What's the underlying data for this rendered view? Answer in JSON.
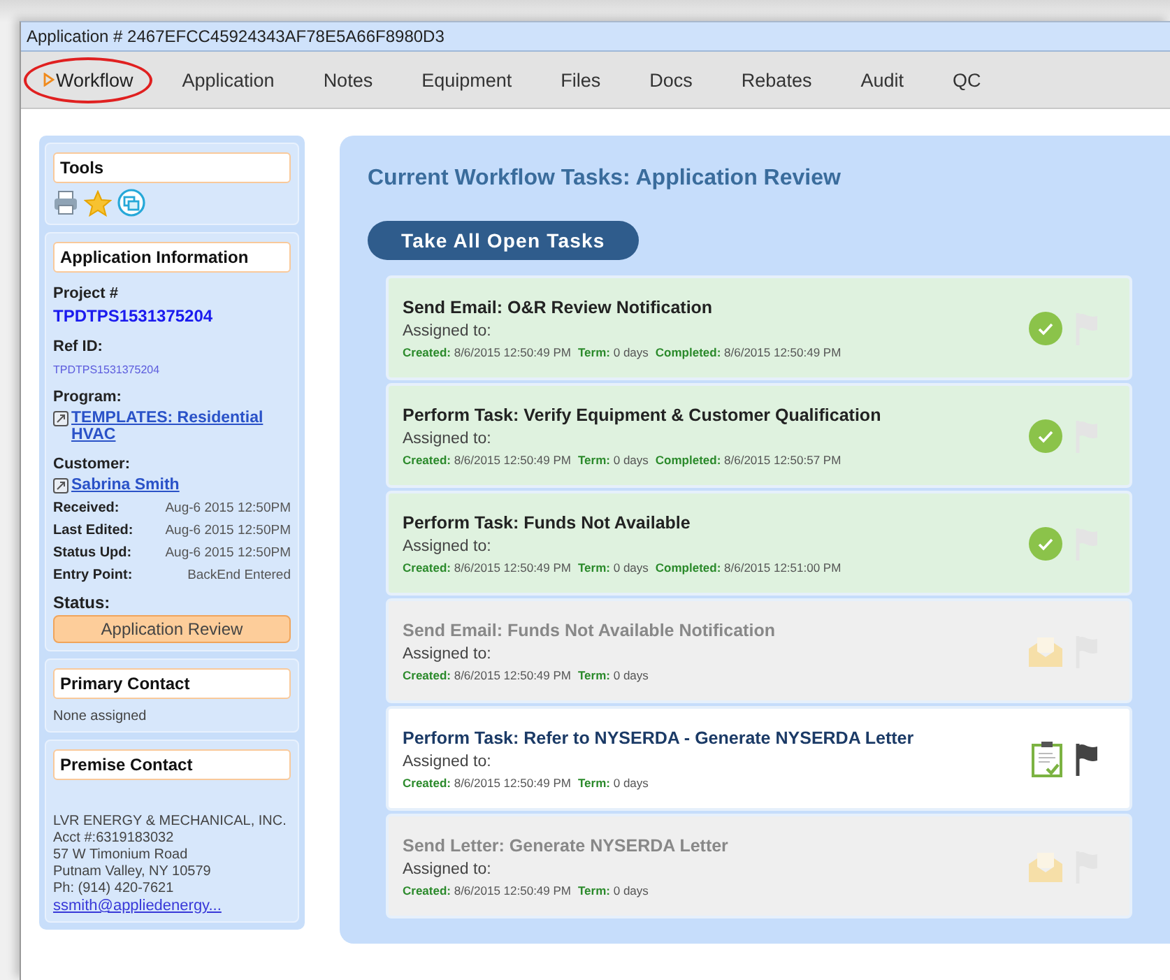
{
  "window": {
    "title": "Application # 2467EFCC45924343AF78E5A66F8980D3"
  },
  "tabs": [
    {
      "label": "Workflow",
      "selected": true,
      "circled": true
    },
    {
      "label": "Application",
      "selected": false,
      "circled": false
    },
    {
      "label": "Notes",
      "selected": false,
      "circled": false
    },
    {
      "label": "Equipment",
      "selected": false,
      "circled": false
    },
    {
      "label": "Files",
      "selected": false,
      "circled": false
    },
    {
      "label": "Docs",
      "selected": false,
      "circled": false
    },
    {
      "label": "Rebates",
      "selected": false,
      "circled": false
    },
    {
      "label": "Audit",
      "selected": false,
      "circled": false
    },
    {
      "label": "QC",
      "selected": false,
      "circled": false
    }
  ],
  "sidebar": {
    "tools": {
      "title": "Tools"
    },
    "info": {
      "title": "Application Information",
      "fields": [
        {
          "kind": "id",
          "label": "Project #",
          "value": "TPDTPS1531375204"
        },
        {
          "kind": "ref",
          "label": "Ref ID:",
          "value": "TPDTPS1531375204"
        },
        {
          "kind": "link",
          "label": "Program:",
          "value": "TEMPLATES: Residential HVAC"
        },
        {
          "kind": "link",
          "label": "Customer:",
          "value": "Sabrina Smith"
        },
        {
          "kind": "inline",
          "label": "Received:",
          "value": "Aug-6 2015 12:50PM"
        },
        {
          "kind": "inline",
          "label": "Last Edited:",
          "value": "Aug-6 2015 12:50PM"
        },
        {
          "kind": "inline",
          "label": "Status Upd:",
          "value": "Aug-6 2015 12:50PM"
        },
        {
          "kind": "inline",
          "label": "Entry Point:",
          "value": "BackEnd Entered"
        },
        {
          "kind": "status",
          "label": "Status:",
          "value": "Application Review"
        }
      ]
    },
    "primary_contact": {
      "title": "Primary Contact",
      "text": "None assigned"
    },
    "premise_contact": {
      "title": "Premise Contact",
      "lines": [
        "LVR ENERGY & MECHANICAL, INC.",
        "Acct #:6319183032",
        "57 W Timonium Road",
        "Putnam Valley, NY 10579",
        "Ph: (914) 420-7621"
      ],
      "email": "ssmith@appliedenergy..."
    }
  },
  "workflow": {
    "title": "Current Workflow Tasks: Application Review",
    "take_button": "Take All Open Tasks",
    "tasks": [
      {
        "kind": "completed",
        "title": "Send Email: O&R Review Notification",
        "assigned": "Assigned to:",
        "meta": [
          {
            "label": "Created:",
            "value": "8/6/2015 12:50:49 PM"
          },
          {
            "label": "Term:",
            "value": "0 days"
          },
          {
            "label": "Completed:",
            "value": "8/6/2015 12:50:49 PM"
          }
        ]
      },
      {
        "kind": "completed",
        "title": "Perform Task: Verify Equipment & Customer Qualification",
        "assigned": "Assigned to:",
        "meta": [
          {
            "label": "Created:",
            "value": "8/6/2015 12:50:49 PM"
          },
          {
            "label": "Term:",
            "value": "0 days"
          },
          {
            "label": "Completed:",
            "value": "8/6/2015 12:50:57 PM"
          }
        ]
      },
      {
        "kind": "completed",
        "title": "Perform Task: Funds Not Available",
        "assigned": "Assigned to:",
        "meta": [
          {
            "label": "Created:",
            "value": "8/6/2015 12:50:49 PM"
          },
          {
            "label": "Term:",
            "value": "0 days"
          },
          {
            "label": "Completed:",
            "value": "8/6/2015 12:51:00 PM"
          }
        ]
      },
      {
        "kind": "waiting",
        "title": "Send Email: Funds Not Available Notification",
        "assigned": "Assigned to:",
        "meta": [
          {
            "label": "Created:",
            "value": "8/6/2015 12:50:49 PM"
          },
          {
            "label": "Term:",
            "value": "0 days"
          }
        ]
      },
      {
        "kind": "active",
        "title": "Perform Task: Refer to NYSERDA - Generate NYSERDA Letter",
        "assigned": "Assigned to:",
        "meta": [
          {
            "label": "Created:",
            "value": "8/6/2015 12:50:49 PM"
          },
          {
            "label": "Term:",
            "value": "0 days"
          }
        ]
      },
      {
        "kind": "waiting",
        "title": "Send Letter: Generate NYSERDA Letter",
        "assigned": "Assigned to:",
        "meta": [
          {
            "label": "Created:",
            "value": "8/6/2015 12:50:49 PM"
          },
          {
            "label": "Term:",
            "value": "0 days"
          }
        ]
      }
    ]
  }
}
